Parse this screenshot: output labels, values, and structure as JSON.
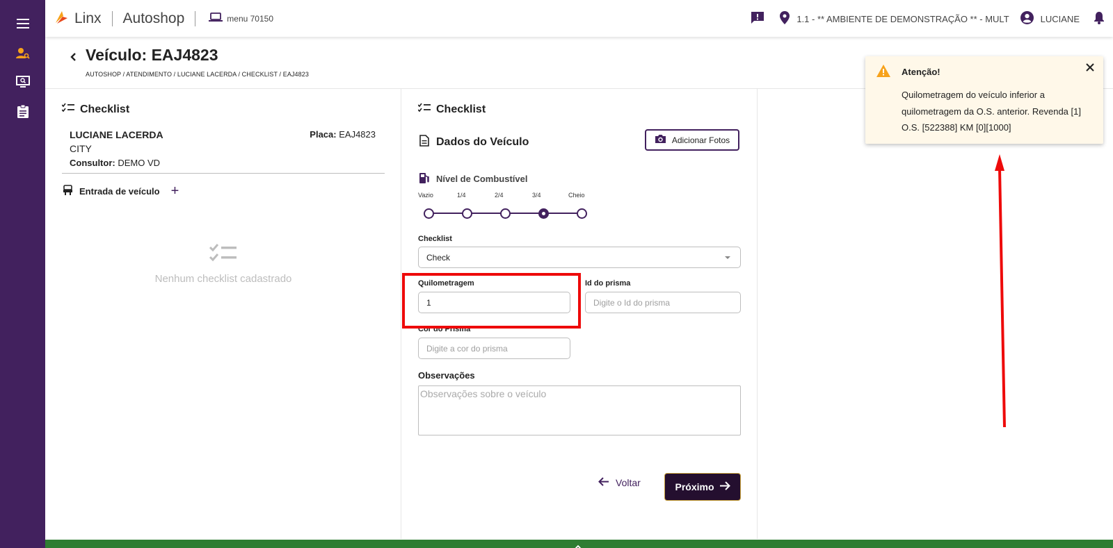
{
  "colors": {
    "sidebar_bg": "#42215e",
    "accent_orange": "#f7a21b",
    "primary": "#42215e",
    "bottom_bar": "#2e7d32",
    "highlight_red": "#ee0a0a"
  },
  "sidebar": {
    "items": [
      {
        "icon": "menu-icon"
      },
      {
        "icon": "person-search-icon",
        "active": true
      },
      {
        "icon": "monitor-search-icon"
      },
      {
        "icon": "clipboard-icon"
      }
    ]
  },
  "topbar": {
    "brand": "Linx",
    "app": "Autoshop",
    "menu_code": "menu 70150",
    "environment": "1.1 - ** AMBIENTE DE DEMONSTRAÇÃO ** - MULT",
    "user": "LUCIANE"
  },
  "header": {
    "title": "Veículo: EAJ4823",
    "breadcrumb": "AUTOSHOP / ATENDIMENTO / LUCIANE LACERDA / CHECKLIST / EAJ4823"
  },
  "left_panel": {
    "title": "Checklist",
    "client_name": "LUCIANE LACERDA",
    "client_city": "CITY",
    "consultant_label": "Consultor:",
    "consultant": "DEMO VD",
    "plate_label": "Placa:",
    "plate": "EAJ4823",
    "entry_label": "Entrada de veículo",
    "empty_message": "Nenhum checklist cadastrado"
  },
  "mid_panel": {
    "title": "Checklist",
    "vehicle_data_title": "Dados do Veículo",
    "add_photos_label": "Adicionar Fotos",
    "fuel_title": "Nível de Combustível",
    "fuel_levels": [
      "Vazio",
      "1/4",
      "2/4",
      "3/4",
      "Cheio"
    ],
    "fuel_selected": "3/4",
    "checklist_label": "Checklist",
    "checklist_value": "Check",
    "mileage_label": "Quilometragem",
    "mileage_value": "1",
    "prism_id_label": "Id do prisma",
    "prism_id_placeholder": "Digite o Id do prisma",
    "prism_color_label": "Cor do Prisma",
    "prism_color_placeholder": "Digite a cor do prisma",
    "obs_label": "Observações",
    "obs_placeholder": "Observações sobre o veículo",
    "back_label": "Voltar",
    "next_label": "Próximo"
  },
  "toast": {
    "title": "Atenção!",
    "message": "Quilometragem do veículo inferior a quilometragem da O.S. anterior. Revenda [1] O.S. [522388] KM [0][1000]"
  }
}
